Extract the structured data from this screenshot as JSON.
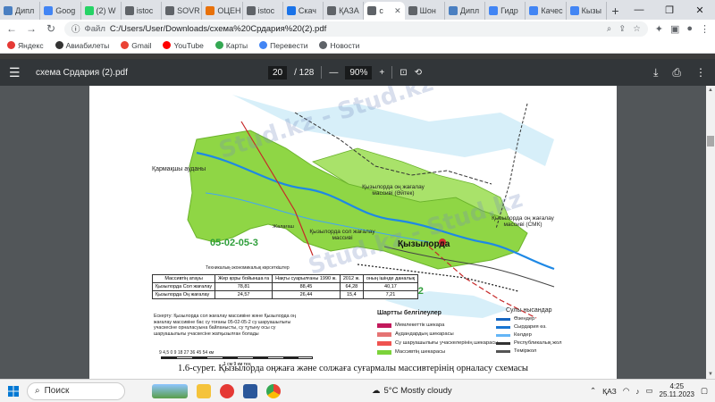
{
  "browser": {
    "tabs": [
      {
        "label": "Дипл",
        "color": "#4a7fc1"
      },
      {
        "label": "Goog",
        "color": "#4285f4"
      },
      {
        "label": "(2) W",
        "color": "#25d366"
      },
      {
        "label": "istoc",
        "color": "#5f6368"
      },
      {
        "label": "SOVR",
        "color": "#5f6368"
      },
      {
        "label": "ОЦЕН",
        "color": "#e8710a"
      },
      {
        "label": "istoc",
        "color": "#5f6368"
      },
      {
        "label": "Скач",
        "color": "#1a73e8"
      },
      {
        "label": "ҚАЗА",
        "color": "#5f6368"
      },
      {
        "label": "с",
        "color": "#5f6368",
        "active": true
      },
      {
        "label": "Шон",
        "color": "#5f6368"
      },
      {
        "label": "Дипл",
        "color": "#4a7fc1"
      },
      {
        "label": "Гидр",
        "color": "#4285f4"
      },
      {
        "label": "Качес",
        "color": "#4285f4"
      },
      {
        "label": "Кызы",
        "color": "#4285f4"
      }
    ],
    "new_tab": "+",
    "address_label": "Файл",
    "address": "C:/Users/User/Downloads/схема%20Срдария%20(2).pdf",
    "bookmarks": [
      {
        "label": "Яндекс",
        "color": "#e53935"
      },
      {
        "label": "Авиабилеты",
        "color": "#333333"
      },
      {
        "label": "Gmail",
        "color": "#ea4335"
      },
      {
        "label": "YouTube",
        "color": "#ff0000"
      },
      {
        "label": "Карты",
        "color": "#34a853"
      },
      {
        "label": "Перевести",
        "color": "#4285f4"
      },
      {
        "label": "Новости",
        "color": "#5f6368"
      }
    ]
  },
  "pdf": {
    "title": "схема Срдария (2).pdf",
    "page_current": "20",
    "page_total": "/ 128",
    "zoom": "90%"
  },
  "map": {
    "watermark": "Stud.kz - Stud.kz",
    "district_label": "Қармақшы ауданы",
    "right_massif": "Қызылорда оң жағалау массиві (Әйтек)",
    "left_massif": "Қызылорда сол жағалау массиві",
    "smk_massif": "Қызылорда оң жағалау массиві (СМК)",
    "city": "Қызылорда",
    "code_left": "05-02-05-3",
    "code_right": "05-02-05-2",
    "small_label": "Жалағаш",
    "canal_label": "Техникалық-экономикалық көрсеткіштер",
    "table": {
      "headers": [
        "Массивтің атауы",
        "Жер қоры бойынша ға",
        "Нақты суарылғаны 1990 ж.",
        "2012 ж.",
        "оның ішінде даналық"
      ],
      "rows": [
        [
          "Қызылорда Сол жағалау",
          "78,81",
          "88,45",
          "64,28",
          "40,17"
        ],
        [
          "Қызылорда Оң жағалау",
          "24,57",
          "26,44",
          "15,4",
          "7,21"
        ]
      ]
    },
    "note": "Ескерту: Қызылорда сол жағалау массивіне және Қызылорда оң жағалау массивіне бас су тоғаны 05-02-05-2 су шаруашылығы учаскесіне орналасуына байланысты, су тұтыну осы су шаруашылығы учаскесіне жатқызылған болады",
    "scale_ticks": "9  4,5  0     9     18     27     36     45     54 км",
    "scale_text": "1 см 9 км тең",
    "legend_title": "Шартты белгілеулер",
    "legend_left": [
      {
        "label": "Мемлекеттік шекара",
        "color": "#c2185b"
      },
      {
        "label": "Аудандардың шекарасы",
        "color": "#e57373"
      },
      {
        "label": "Су шаруашылығы учаскелерінің шекарасы",
        "color": "#ef5350"
      },
      {
        "label": "Массивтің шекарасы",
        "color": "#7cd33a"
      }
    ],
    "legend_right_title": "Сулы нысандар",
    "legend_right": [
      {
        "label": "Өзендер",
        "color": "#1565c0"
      },
      {
        "label": "Сырдария өз.",
        "color": "#1976d2"
      },
      {
        "label": "Көлдер",
        "color": "#64b5f6"
      },
      {
        "label": "Республикалық жол",
        "color": "#333333"
      },
      {
        "label": "Теміржол",
        "color": "#555555"
      }
    ],
    "caption": "1.6-сурет. Қызылорда оңжаға және солжаға суғармалы массивтерінің орналасу схемасы"
  },
  "taskbar": {
    "search_placeholder": "Поиск",
    "weather": "5°C  Mostly cloudy",
    "lang": "ҚАЗ",
    "time": "4:25",
    "date": "25.11.2023"
  }
}
